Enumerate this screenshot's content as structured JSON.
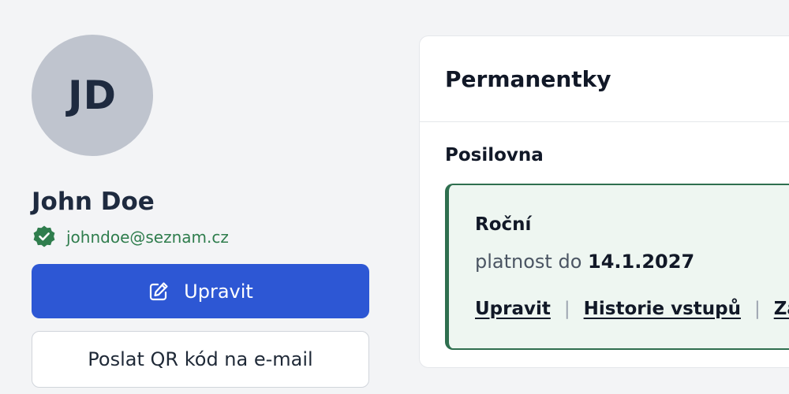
{
  "profile": {
    "initials": "JD",
    "name": "John Doe",
    "email": "johndoe@seznam.cz",
    "edit_label": "Upravit",
    "send_qr_label": "Poslat QR kód na e-mail",
    "email_verified_icon": "verified-badge-icon",
    "edit_icon": "pencil-icon"
  },
  "memberships": {
    "title": "Permanentky",
    "section": "Posilovna",
    "pass": {
      "name": "Roční",
      "validity_prefix": "platnost do",
      "valid_until": "14.1.2027",
      "links": {
        "edit": "Upravit",
        "history": "Historie vstupů",
        "third": "Zaz"
      },
      "separator": "|"
    }
  },
  "colors": {
    "primary": "#2d57d4",
    "verified": "#2f7d4d",
    "pass_border": "#2f6f4f",
    "pass_bg": "#eef6f1",
    "avatar_bg": "#bfc4ce"
  }
}
